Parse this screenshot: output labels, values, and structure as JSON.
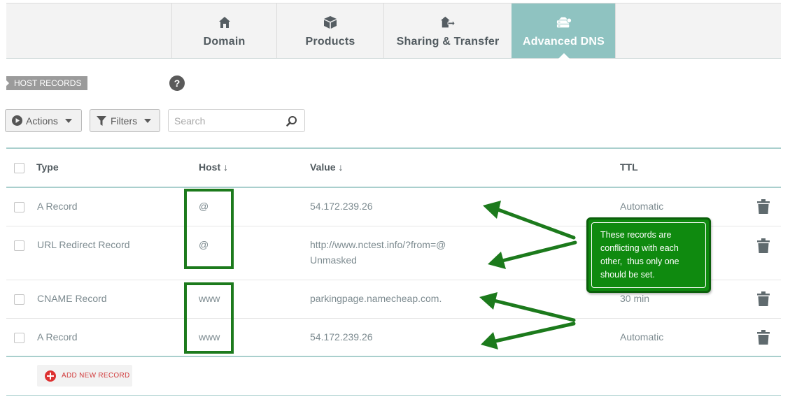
{
  "tabs": [
    {
      "label": "Domain",
      "icon": "home-icon",
      "active": false
    },
    {
      "label": "Products",
      "icon": "box-icon",
      "active": false
    },
    {
      "label": "Sharing & Transfer",
      "icon": "transfer-icon",
      "active": false
    },
    {
      "label": "Advanced DNS",
      "icon": "dns-server-icon",
      "active": true
    }
  ],
  "section": {
    "title": "HOST RECORDS",
    "help": "?"
  },
  "toolbar": {
    "actions_label": "Actions",
    "filters_label": "Filters",
    "search_placeholder": "Search"
  },
  "table": {
    "headers": {
      "type": "Type",
      "host": "Host ↓",
      "value": "Value ↓",
      "ttl": "TTL"
    },
    "rows": [
      {
        "type": "A Record",
        "host": "@",
        "value": "54.172.239.26",
        "value2": "",
        "ttl": "Automatic"
      },
      {
        "type": "URL Redirect Record",
        "host": "@",
        "value": "http://www.nctest.info/?from=@",
        "value2": "Unmasked",
        "ttl": ""
      },
      {
        "type": "CNAME Record",
        "host": "www",
        "value": "parkingpage.namecheap.com.",
        "value2": "",
        "ttl": "30 min"
      },
      {
        "type": "A Record",
        "host": "www",
        "value": "54.172.239.26",
        "value2": "",
        "ttl": "Automatic"
      }
    ]
  },
  "add_record_label": "ADD NEW RECORD",
  "annotation": {
    "lines": [
      "These records are",
      "conflicting with each",
      "other,  thus only one",
      "should be set."
    ]
  },
  "colors": {
    "accent": "#8fc3c1",
    "annotation_green": "#0f8a0f",
    "delete_red": "#dd3131"
  }
}
